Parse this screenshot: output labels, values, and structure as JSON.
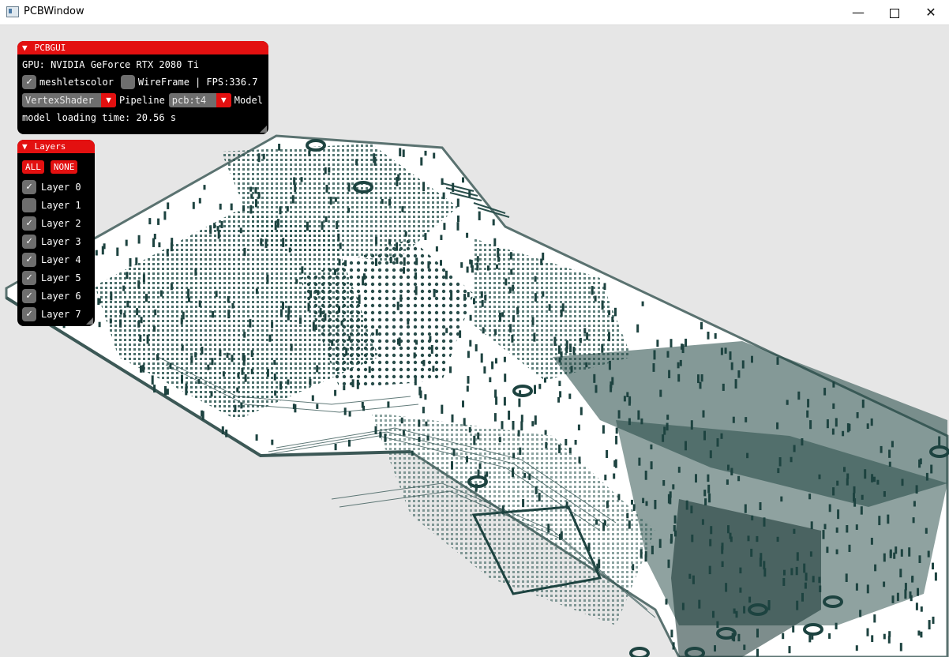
{
  "window": {
    "title": "PCBWindow",
    "minimize_label": "—",
    "close_label": "✕"
  },
  "pcbgui": {
    "title": "PCBGUI",
    "gpu_text": "GPU: NVIDIA GeForce RTX 2080 Ti",
    "meshletscolor_label": "meshletscolor",
    "wireframe_label": "WireFrame",
    "fps_text": "| FPS:336.7",
    "pipeline_value": "VertexShader",
    "pipeline_label": "Pipeline",
    "model_value": "pcb:t4",
    "model_label": "Model",
    "loading_text": "model loading time: 20.56 s",
    "meshletscolor_checked": true,
    "wireframe_checked": false
  },
  "layers": {
    "title": "Layers",
    "all_label": "ALL",
    "none_label": "NONE",
    "items": [
      {
        "label": "Layer 0",
        "checked": true
      },
      {
        "label": "Layer 1",
        "checked": false
      },
      {
        "label": "Layer 2",
        "checked": true
      },
      {
        "label": "Layer 3",
        "checked": true
      },
      {
        "label": "Layer 4",
        "checked": true
      },
      {
        "label": "Layer 5",
        "checked": true
      },
      {
        "label": "Layer 6",
        "checked": true
      },
      {
        "label": "Layer 7",
        "checked": true
      }
    ]
  },
  "colors": {
    "accent": "#e31010",
    "board_fill": "#2f4f4c",
    "board_dark": "#1b3a38",
    "background": "#e6e6e6"
  },
  "icons": {
    "check": "✓",
    "collapse": "▼"
  }
}
